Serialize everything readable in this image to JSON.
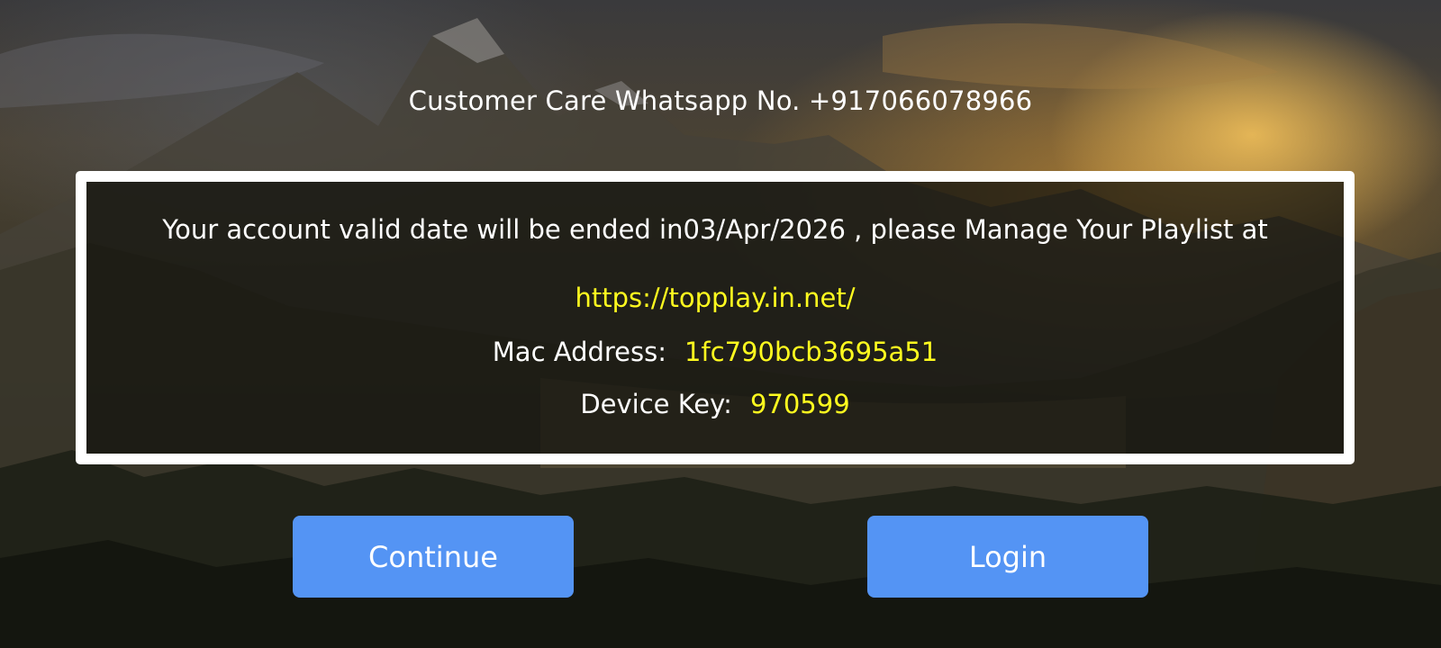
{
  "header": {
    "customer_care": "Customer Care Whatsapp No. +917066078966"
  },
  "info_box": {
    "validity_message": "Your account valid date will be ended in03/Apr/2026 , please Manage Your Playlist at",
    "playlist_url": "https://topplay.in.net/",
    "mac_label": "Mac Address:",
    "mac_value": "1fc790bcb3695a51",
    "device_key_label": "Device Key:",
    "device_key_value": "970599"
  },
  "buttons": {
    "continue_label": "Continue",
    "login_label": "Login"
  },
  "colors": {
    "accent_button": "#5494f4",
    "highlight_text": "#fffb1f",
    "border": "#ffffff"
  }
}
